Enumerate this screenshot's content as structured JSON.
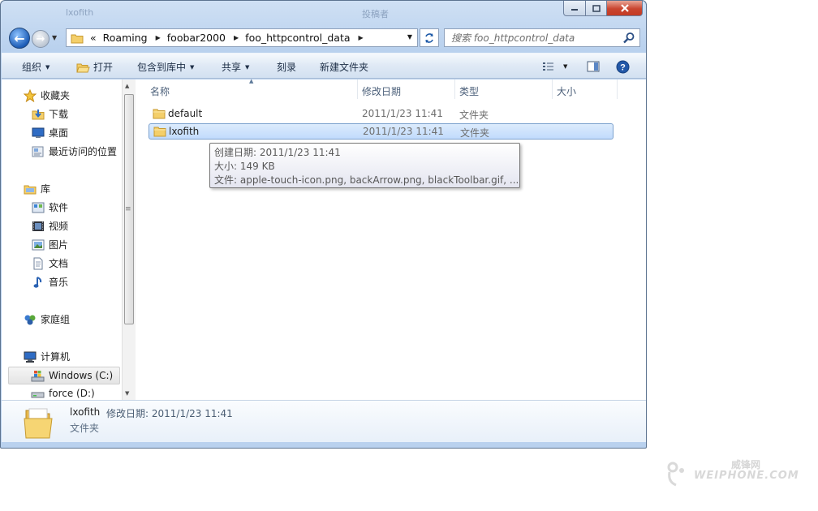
{
  "titlebar": {
    "ghost_title_left": "lxofith",
    "ghost_title_right": "投稿者"
  },
  "address": {
    "overflow": "«",
    "crumbs": [
      "Roaming",
      "foobar2000",
      "foo_httpcontrol_data"
    ],
    "search_placeholder": "搜索 foo_httpcontrol_data"
  },
  "toolbar": {
    "organize": "组织",
    "open": "打开",
    "include_in_library": "包含到库中",
    "share": "共享",
    "burn": "刻录",
    "new_folder": "新建文件夹"
  },
  "nav": {
    "favorites": "收藏夹",
    "downloads": "下载",
    "desktop": "桌面",
    "recent_places": "最近访问的位置",
    "libraries": "库",
    "software": "软件",
    "videos": "视频",
    "pictures": "图片",
    "documents": "文档",
    "music": "音乐",
    "homegroup": "家庭组",
    "computer": "计算机",
    "drive_c": "Windows (C:)",
    "drive_d": "force (D:)"
  },
  "columns": {
    "name": "名称",
    "date_modified": "修改日期",
    "type": "类型",
    "size": "大小"
  },
  "files": [
    {
      "name": "default",
      "date": "2011/1/23 11:41",
      "type": "文件夹"
    },
    {
      "name": "lxofith",
      "date": "2011/1/23 11:41",
      "type": "文件夹"
    }
  ],
  "tooltip": {
    "created": "创建日期: 2011/1/23 11:41",
    "size": "大小: 149 KB",
    "files": "文件: apple-touch-icon.png, backArrow.png, blackToolbar.gif, ..."
  },
  "details": {
    "name": "lxofith",
    "modified_label": "修改日期:",
    "modified_value": "2011/1/23 11:41",
    "type": "文件夹"
  },
  "watermark": {
    "text": "WEIPHONE.COM",
    "cn": "威锋网"
  },
  "colors": {
    "selection": "#c1dbfc",
    "selection_border": "#7da2ce",
    "folder": "#f4cf6a",
    "chrome": "#b9d1ee"
  }
}
